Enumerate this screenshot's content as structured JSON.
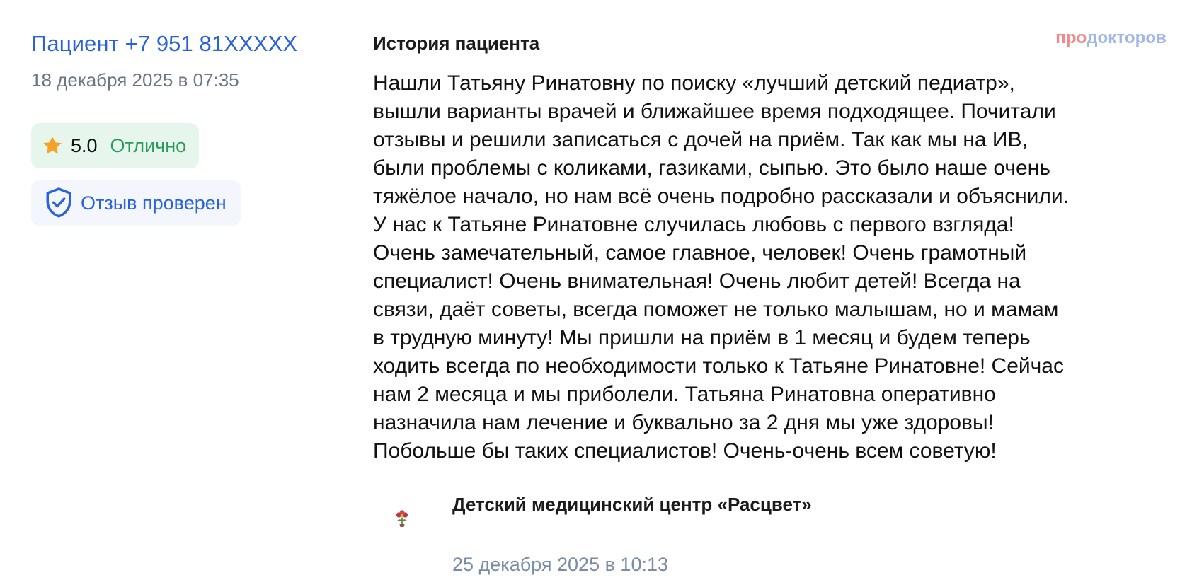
{
  "review": {
    "author": "Пациент +7 951 81XXXXX",
    "date": "18 декабря 2025 в 07:35",
    "rating": {
      "score": "5.0",
      "label": "Отлично",
      "icon": "star-icon",
      "color": "#f4a327"
    },
    "verified": {
      "label": "Отзыв проверен",
      "icon": "shield-check-icon"
    }
  },
  "history": {
    "title": "История пациента",
    "lines": [
      "Нашли Татьяну Ринатовну по поиску «лучший детский педиатр»,",
      "вышли варианты врачей и ближайшее время подходящее. Почитали",
      "отзывы и решили записаться с дочей на приём. Так как мы на ИВ,",
      "были проблемы с коликами, газиками, сыпью. Это было наше очень",
      "тяжёлое начало, но нам всё очень подробно рассказали и объяснили.",
      "У нас к Татьяне Ринатовне случилась любовь с первого взгляда!",
      "Очень замечательный, самое главное, человек! Очень грамотный",
      "специалист! Очень внимательная! Очень любит детей! Всегда на",
      "связи, даёт советы, всегда поможет не только малышам, но и мамам",
      "в трудную минуту! Мы пришли на приём в 1 месяц и будем теперь",
      "ходить всегда по необходимости только к Татьяне Ринатовне! Сейчас",
      "нам 2 месяца и мы приболели. Татьяна Ринатовна оперативно",
      "назначила нам лечение и буквально за 2 дня мы уже здоровы!",
      "Побольше бы таких специалистов! Очень-очень всем советую!"
    ]
  },
  "brand": {
    "part1": "про",
    "part2": "докторов"
  },
  "clinic": {
    "name": "Детский медицинский центр «Расцвет»",
    "logo_icon": "flower-logo-icon",
    "visit_date": "25 декабря 2025 в 10:13"
  },
  "colors": {
    "link": "#2a63d8",
    "rating_bg": "#e6f6ed",
    "rating_text": "#2b9a5c",
    "verified_bg": "#f3f6fc",
    "muted": "#6b7684",
    "visit_date": "#7a8ca6"
  }
}
